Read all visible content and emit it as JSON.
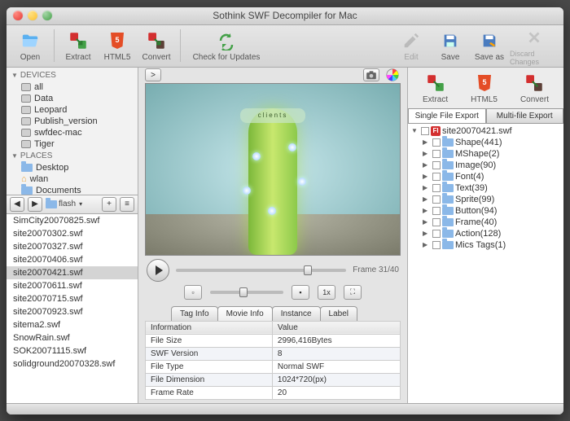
{
  "window": {
    "title": "Sothink SWF Decompiler for Mac"
  },
  "toolbar": {
    "open": "Open",
    "extract": "Extract",
    "html5": "HTML5",
    "convert": "Convert",
    "updates": "Check for Updates",
    "edit": "Edit",
    "save": "Save",
    "saveas": "Save as",
    "discard": "Discard Changes"
  },
  "sidebar": {
    "sec_devices": "DEVICES",
    "devices": [
      "all",
      "Data",
      "Leopard",
      "Publish_version",
      "swfdec-mac",
      "Tiger"
    ],
    "sec_places": "PLACES",
    "places": [
      "Desktop",
      "wlan",
      "Documents"
    ],
    "breadcrumb": "flash",
    "files": [
      "SimCity20070825.swf",
      "site20070302.swf",
      "site20070327.swf",
      "site20070406.swf",
      "site20070421.swf",
      "site20070611.swf",
      "site20070715.swf",
      "site20070923.swf",
      "sitema2.swf",
      "SnowRain.swf",
      "SOK20071115.swf",
      "solidground20070328.swf"
    ],
    "selected_file": "site20070421.swf"
  },
  "preview": {
    "label": "clients",
    "frame_text": "Frame 31/40",
    "zoom": "1x"
  },
  "tabs": {
    "tag": "Tag Info",
    "movie": "Movie Info",
    "instance": "Instance",
    "label": "Label"
  },
  "info": {
    "h1": "Information",
    "h2": "Value",
    "rows": [
      [
        "File Size",
        "2996,416Bytes"
      ],
      [
        "SWF Version",
        "8"
      ],
      [
        "File Type",
        "Normal SWF"
      ],
      [
        "File Dimension",
        "1024*720(px)"
      ],
      [
        "Frame Rate",
        "20"
      ]
    ]
  },
  "right": {
    "extract": "Extract",
    "html5": "HTML5",
    "convert": "Convert",
    "tab_single": "Single File Export",
    "tab_multi": "Multi-file Export",
    "root": "site20070421.swf",
    "nodes": [
      "Shape(441)",
      "MShape(2)",
      "Image(90)",
      "Font(4)",
      "Text(39)",
      "Sprite(99)",
      "Button(94)",
      "Frame(40)",
      "Action(128)",
      "Mics Tags(1)"
    ]
  }
}
